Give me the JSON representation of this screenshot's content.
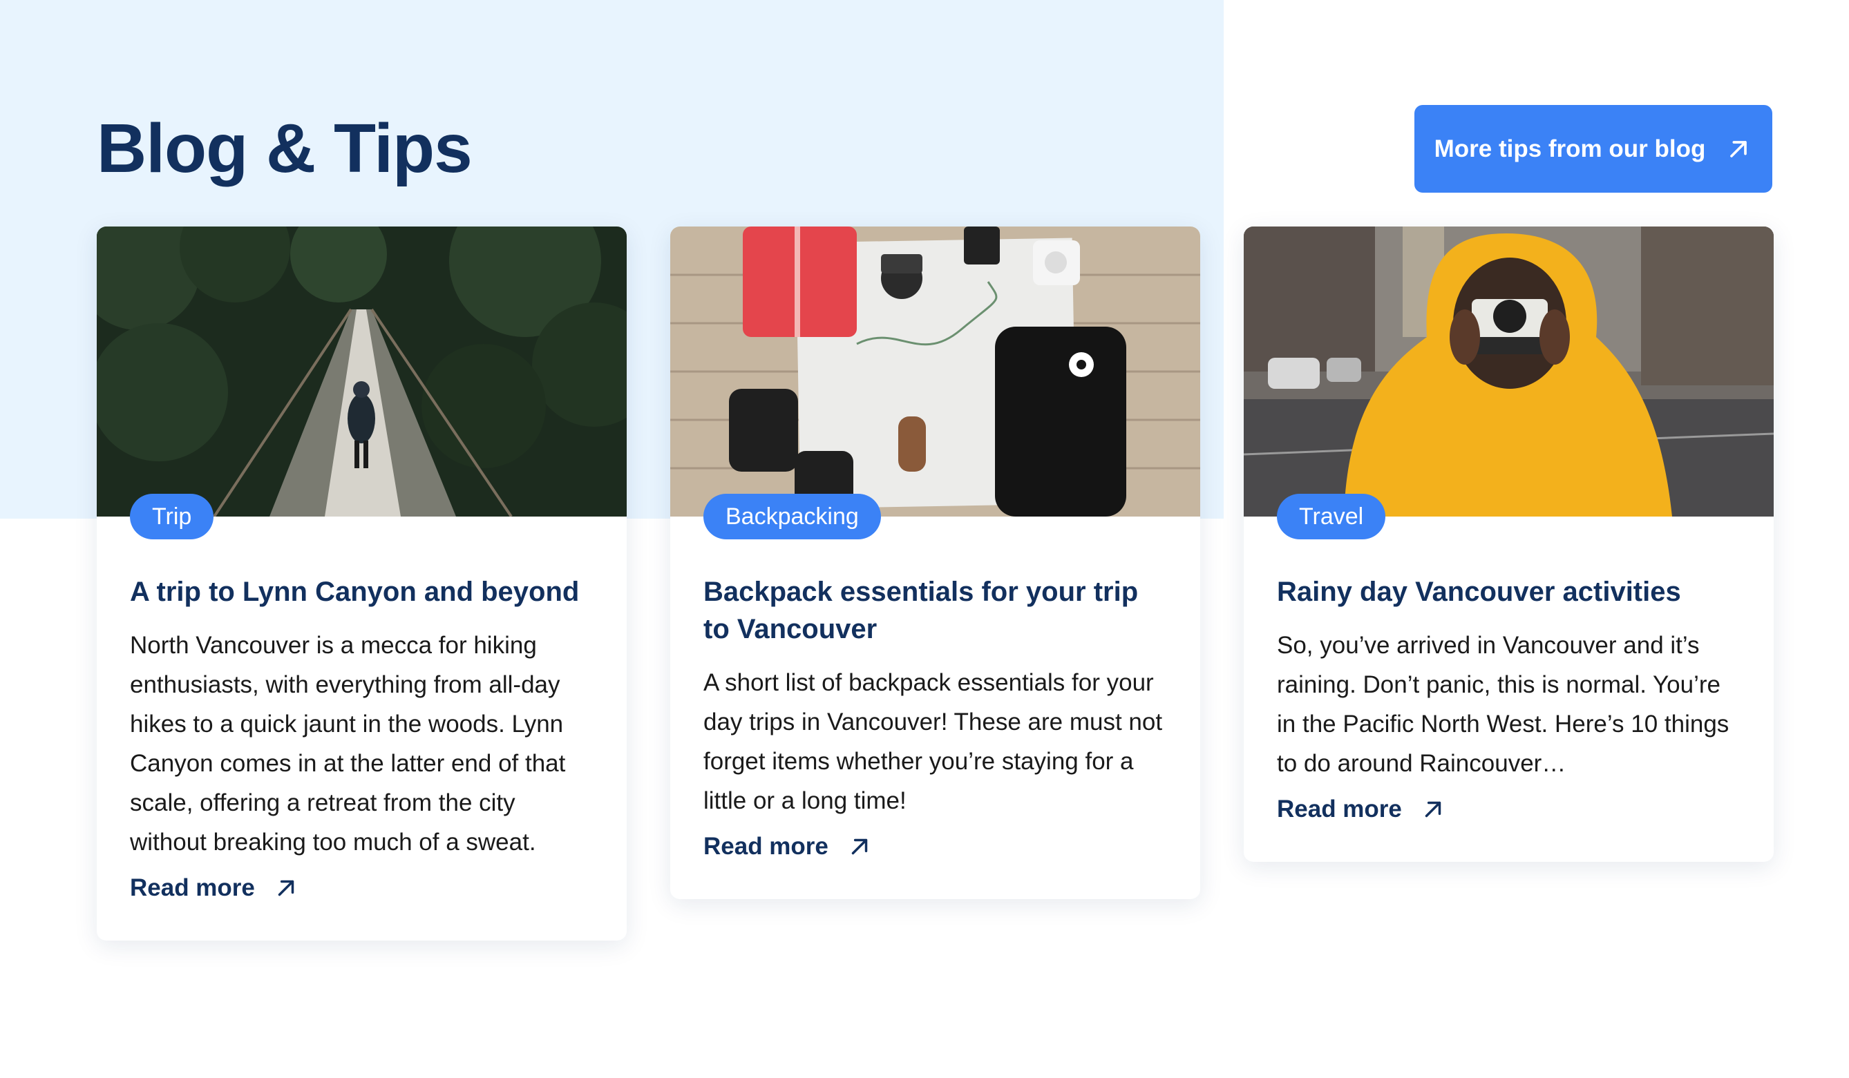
{
  "section": {
    "title": "Blog & Tips",
    "cta_label": "More tips from our blog"
  },
  "colors": {
    "accent": "#3b82f6",
    "heading": "#12305e",
    "tint": "#e8f4fe"
  },
  "cards": [
    {
      "tag": "Trip",
      "title": "A trip to Lynn Canyon and beyond",
      "excerpt": "North Vancouver is a mecca for hiking enthusiasts, with everything from all-day hikes to a quick jaunt in the woods. Lynn Canyon comes in at the latter end of that scale, offering a retreat from the city without breaking too much of a sweat.",
      "link_label": "Read more",
      "image_icon": "suspension-bridge-photo"
    },
    {
      "tag": "Backpacking",
      "title": "Backpack essentials for your trip to Vancouver",
      "excerpt": "A short list of backpack essentials for your day trips in Vancouver! These are must not forget items whether you’re staying for a little or a long time!",
      "link_label": "Read more",
      "image_icon": "backpack-flatlay-photo"
    },
    {
      "tag": "Travel",
      "title": "Rainy day Vancouver activities",
      "excerpt": "So, you’ve arrived in Vancouver and it’s raining. Don’t panic, this is normal. You’re in the Pacific North West. Here’s 10 things to do around Raincouver…",
      "link_label": "Read more",
      "image_icon": "yellow-raincoat-photographer-photo"
    }
  ]
}
